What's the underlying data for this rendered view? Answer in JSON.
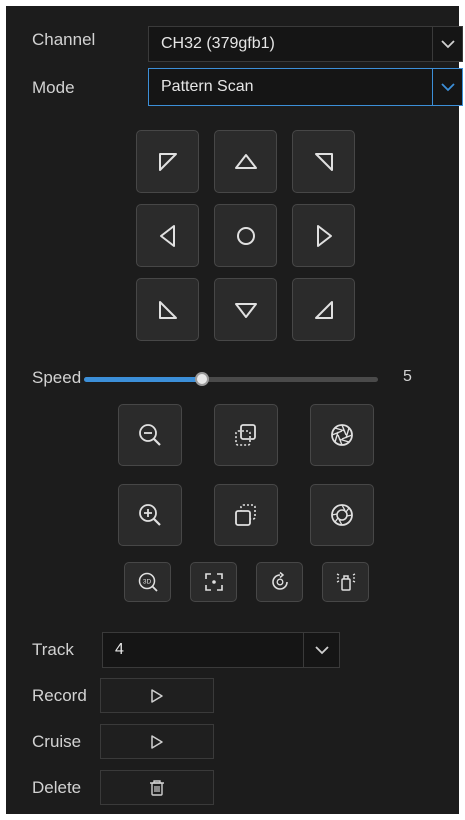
{
  "channel": {
    "label": "Channel",
    "value": "CH32 (379gfb1)"
  },
  "mode": {
    "label": "Mode",
    "value": "Pattern Scan"
  },
  "ptz": {
    "directions": [
      "up-left",
      "up",
      "up-right",
      "left",
      "center",
      "right",
      "down-left",
      "down",
      "down-right"
    ]
  },
  "speed": {
    "label": "Speed",
    "value": "5",
    "fraction": 0.4
  },
  "lens_controls": {
    "row1": [
      "zoom-out-icon",
      "focus-near-icon",
      "iris-close-icon"
    ],
    "row2": [
      "zoom-in-icon",
      "focus-far-icon",
      "iris-open-icon"
    ],
    "tools": [
      "3d-zoom-icon",
      "region-focus-icon",
      "lens-reset-icon",
      "wiper-icon"
    ]
  },
  "track": {
    "label": "Track",
    "value": "4"
  },
  "record": {
    "label": "Record"
  },
  "cruise": {
    "label": "Cruise"
  },
  "delete": {
    "label": "Delete"
  },
  "colors": {
    "accent": "#3c8fd8",
    "panel": "#1c1c1c",
    "button": "#2b2b2b"
  }
}
